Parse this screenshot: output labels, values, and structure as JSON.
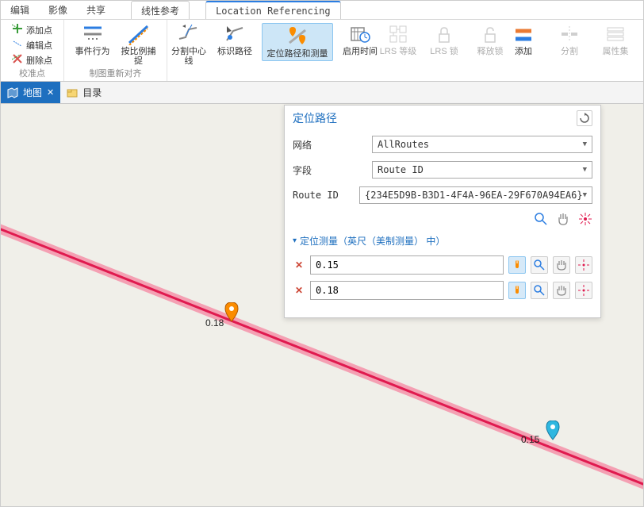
{
  "menu": {
    "edit": "编辑",
    "image": "影像",
    "share": "共享",
    "linear_ref": "线性参考",
    "location_ref": "Location Referencing"
  },
  "ribbon": {
    "group1": {
      "add_point": "添加点",
      "edit_point": "编辑点",
      "remove_point": "删除点",
      "caption": "校准点"
    },
    "event_behavior": "事件行为",
    "scale_capture": "按比例捕捉",
    "split_centerline": "分割中心线",
    "identify_route": "标识路径",
    "locate_route_measure": "定位路径和测量",
    "enable_time": "启用时间",
    "lrs_level": "LRS 等级",
    "lrs_lock": "LRS 锁",
    "release_lock": "释放锁",
    "add": "添加",
    "split": "分割",
    "attributes": "属性集",
    "map_reset_caption": "制图重新对齐"
  },
  "view_tabs": {
    "map": "地图",
    "catalog": "目录"
  },
  "panel": {
    "title": "定位路径",
    "network_label": "网络",
    "network_value": "AllRoutes",
    "field_label": "字段",
    "field_value": "Route ID",
    "routeid_label": "Route ID",
    "routeid_value": "{234E5D9B-B3D1-4F4A-96EA-29F670A94EA6}",
    "section_title": "定位测量（英尺（美制测量） 中）",
    "measure1": "0.15",
    "measure2": "0.18"
  },
  "markers": {
    "m1": "0.18",
    "m2": "0.15"
  }
}
